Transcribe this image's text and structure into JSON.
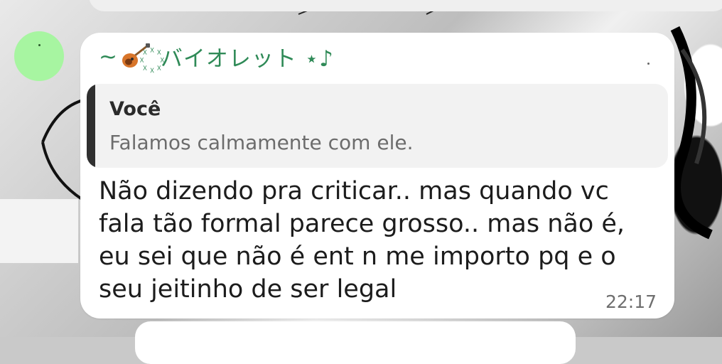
{
  "chat": {
    "sender_name": "~🎸꙰ バイオレット ⋆♪",
    "sender_prefix": "~",
    "sender_icon": "guitar-icon",
    "sender_suffix": "꙰ バイオレット ⋆♪",
    "avatar_color": "#a7f5a1",
    "name_color": "#2f8a57",
    "reply": {
      "author": "Você",
      "text": "Falamos calmamente com ele."
    },
    "message_lines": [
      "Não dizendo pra criticar.. mas quando vc",
      "fala tão formal parece grosso.. mas não é,",
      "eu sei que não é ent n me importo pq e o",
      "seu jeitinho de ser legal"
    ],
    "timestamp": "22:17"
  }
}
